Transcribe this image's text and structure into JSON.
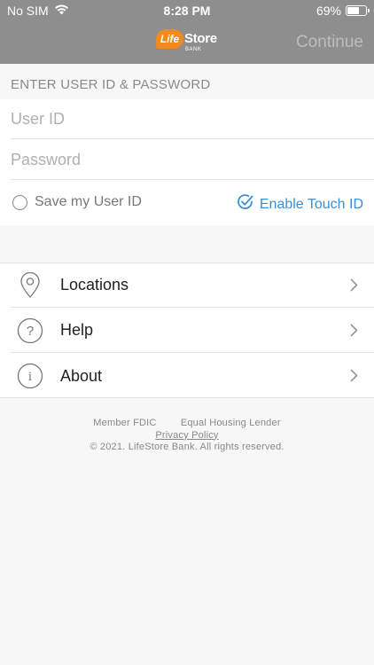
{
  "status_bar": {
    "carrier": "No SIM",
    "time": "8:28 PM",
    "battery": "69%",
    "battery_level": 0.69
  },
  "header": {
    "logo": {
      "life": "Life",
      "store": "Store",
      "bank": "BANK"
    },
    "continue_label": "Continue"
  },
  "login": {
    "section_title": "ENTER USER ID & PASSWORD",
    "user_id_placeholder": "User ID",
    "password_placeholder": "Password",
    "save_user_id_label": "Save my User ID",
    "enable_touch_id_label": "Enable Touch ID"
  },
  "menu": {
    "items": [
      {
        "label": "Locations",
        "icon": "location-pin-icon"
      },
      {
        "label": "Help",
        "icon": "question-circle-icon"
      },
      {
        "label": "About",
        "icon": "info-circle-icon"
      }
    ]
  },
  "footer": {
    "member_fdic": "Member FDIC",
    "equal_housing": "Equal Housing Lender",
    "privacy_policy": "Privacy Policy",
    "copyright": "© 2021. LifeStore Bank. All rights reserved."
  },
  "colors": {
    "header_bg": "#8e8e8e",
    "accent_blue": "#3a8fd8",
    "logo_orange": "#f28a1e"
  }
}
